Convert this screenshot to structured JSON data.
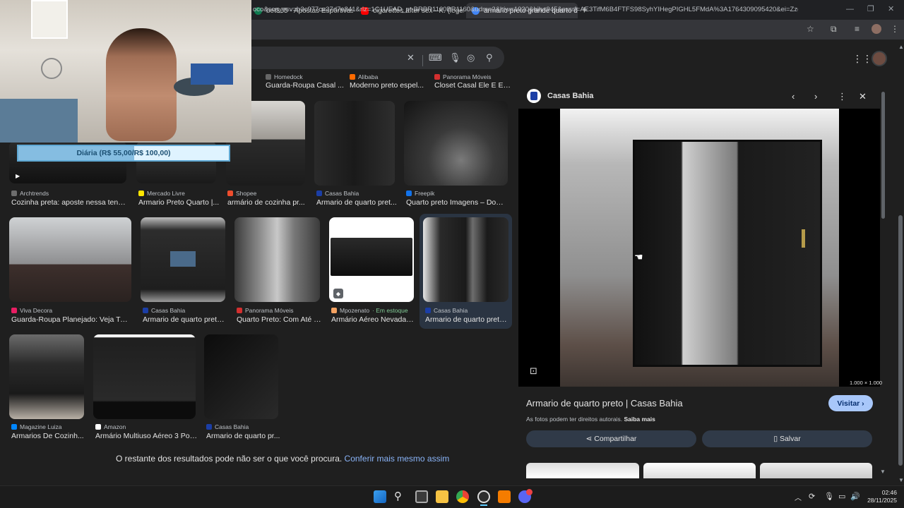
{
  "browser": {
    "tabs": [
      {
        "title": "bet365 - Apostas Esportivas On",
        "fav_color": "#0f7b4f"
      },
      {
        "title": "cigarettes after sex - K. (legendad",
        "fav_color": "#ff0000"
      },
      {
        "title": "armario preto grande quarto de",
        "fav_color": "#4285f4",
        "active": true
      }
    ],
    "new_tab": "+",
    "url": "oco&sca_esv=b3c977ca37d7e841&rlz=1C1UEAD_pt-BRBR1160BR1160&udm=2&biw=1920&bih=945&sxsrf=AE3TifM6B4FTFS98SyhYIHegPIGHL5FMdA%3A1764309095420&ei=ZzgpaYe0..."
  },
  "search": {
    "icons": [
      "close-icon",
      "keyboard-icon",
      "mic-icon",
      "lens-icon",
      "search-icon"
    ]
  },
  "results": {
    "row0": [
      {
        "source": "Homedock",
        "caption": "Guarda-Roupa Casal ...",
        "fav": "#555"
      },
      {
        "source": "Alibaba",
        "caption": "Moderno preto espel...",
        "fav": "#ff6a00"
      },
      {
        "source": "Panorama Móveis",
        "caption": "Closet Casal Ele E El...",
        "fav": "#d32f2f"
      }
    ],
    "row1": [
      {
        "source": "Archtrends",
        "caption": "Cozinha preta: aposte nessa tendê...",
        "fav": "#6d6d6d"
      },
      {
        "source": "Mercado Livre",
        "caption": "Armario Preto Quarto |...",
        "fav": "#ffe600"
      },
      {
        "source": "Shopee",
        "caption": "armário de cozinha pr...",
        "fav": "#ee4d2d"
      },
      {
        "source": "Casas Bahia",
        "caption": "Armario de quarto pret...",
        "fav": "#1b3ea6"
      },
      {
        "source": "Freepik",
        "caption": "Quarto preto Imagens – Downl...",
        "fav": "#1273eb"
      }
    ],
    "row2": [
      {
        "source": "Viva Decora",
        "caption": "Guarda-Roupa Planejado: Veja Tudo...",
        "fav": "#e91e63"
      },
      {
        "source": "Casas Bahia",
        "caption": "Armario de quarto preto ...",
        "fav": "#1b3ea6"
      },
      {
        "source": "Panorama Móveis",
        "caption": "Quarto Preto: Com Até 5...",
        "fav": "#d32f2f"
      },
      {
        "source": "Mpozenato",
        "stock": "· Em estoque",
        "caption": "Armário Aéreo Nevada c...",
        "fav": "#f4a261"
      },
      {
        "source": "Casas Bahia",
        "caption": "Armario de quarto preto ...",
        "fav": "#1b3ea6"
      }
    ],
    "row3": [
      {
        "source": "Magazine Luiza",
        "caption": "Armarios De Cozinh...",
        "fav": "#0086ff"
      },
      {
        "source": "Amazon",
        "caption": "Armário Multiuso Aéreo 3 Port...",
        "fav": "#ffffff"
      },
      {
        "source": "Casas Bahia",
        "caption": "Armario de quarto pr...",
        "fav": "#1b3ea6"
      }
    ],
    "more_text": "O restante dos resultados pode não ser o que você procura.",
    "more_link": "Conferir mais mesmo assim"
  },
  "panel": {
    "site": "Casas Bahia",
    "dimensions": "1.000 × 1.000",
    "title": "Armario de quarto preto | Casas Bahia",
    "visit": "Visitar",
    "copyright": "As fotos podem ter direitos autorais.",
    "learn_more": "Saiba mais",
    "share": "Compartilhar",
    "save": "Salvar"
  },
  "overlay": {
    "label": "Diária (R$ 55,00/R$ 100,00)",
    "progress": 0.55
  },
  "taskbar": {
    "time": "02:46",
    "date": "28/11/2025"
  }
}
